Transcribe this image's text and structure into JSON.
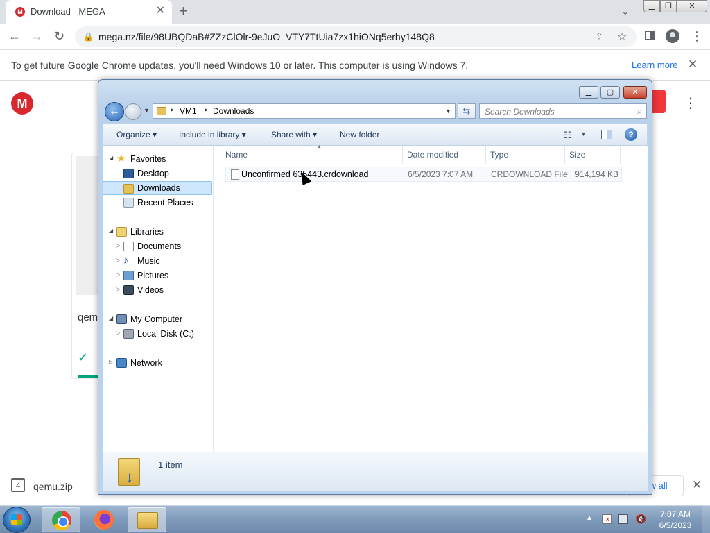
{
  "browser": {
    "tab_title": "Download - MEGA",
    "tab_favicon": "M",
    "tab_close": "✕",
    "new_tab": "+",
    "tab_search": "⌄",
    "url": "mega.nz/file/98UBQDaB#ZZzClOlr-9eJuO_VTY7TtUia7zx1hiONq5erhy148Q8",
    "window_min": "▁",
    "window_max": "❐",
    "window_close": "✕",
    "nav_back": "←",
    "nav_forward": "→",
    "nav_reload": "↻",
    "menu": "⋮"
  },
  "infobar": {
    "message": "To get future Google Chrome updates, you'll need Windows 10 or later. This computer is using Windows 7.",
    "link": "Learn more",
    "close": "✕"
  },
  "mega": {
    "logo": "M",
    "button_partial": "t",
    "menu": "⋮",
    "file_name_partial": "qem",
    "check": "✓",
    "accent_color": "#d9272e"
  },
  "downloads": {
    "file_name": "qemu.zip",
    "show_all_partial": "ow all",
    "close": "✕"
  },
  "explorer": {
    "path": [
      "VM1",
      "Downloads"
    ],
    "search_placeholder": "Search Downloads",
    "toolbar": {
      "organize": "Organize ▾",
      "include_in_library": "Include in library ▾",
      "share_with": "Share with ▾",
      "new_folder": "New folder"
    },
    "nav": {
      "favorites": "Favorites",
      "desktop": "Desktop",
      "downloads": "Downloads",
      "recent_places": "Recent Places",
      "libraries": "Libraries",
      "documents": "Documents",
      "music": "Music",
      "pictures": "Pictures",
      "videos": "Videos",
      "my_computer": "My Computer",
      "local_disk": "Local Disk (C:)",
      "network": "Network"
    },
    "columns": {
      "name": "Name",
      "date_modified": "Date modified",
      "type": "Type",
      "size": "Size"
    },
    "files": [
      {
        "name": "Unconfirmed 635443.crdownload",
        "date_modified": "6/5/2023 7:07 AM",
        "type": "CRDOWNLOAD File",
        "size": "914,194 KB"
      }
    ],
    "status": "1 item"
  },
  "taskbar": {
    "time": "7:07 AM",
    "date": "6/5/2023"
  }
}
